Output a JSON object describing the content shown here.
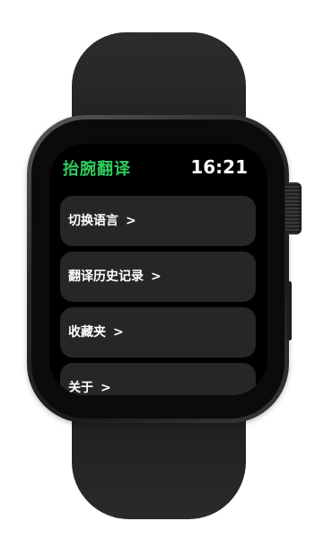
{
  "header": {
    "app_title": "抬腕翻译",
    "time": "16:21"
  },
  "menu": {
    "items": [
      {
        "label": "切换语言",
        "arrow": ">"
      },
      {
        "label": "翻译历史记录",
        "arrow": ">"
      },
      {
        "label": "收藏夹",
        "arrow": ">"
      },
      {
        "label": "关于",
        "arrow": ">"
      }
    ]
  },
  "colors": {
    "accent": "#2ecc5f",
    "background": "#000000",
    "item_bg": "#262626",
    "text": "#ffffff"
  }
}
